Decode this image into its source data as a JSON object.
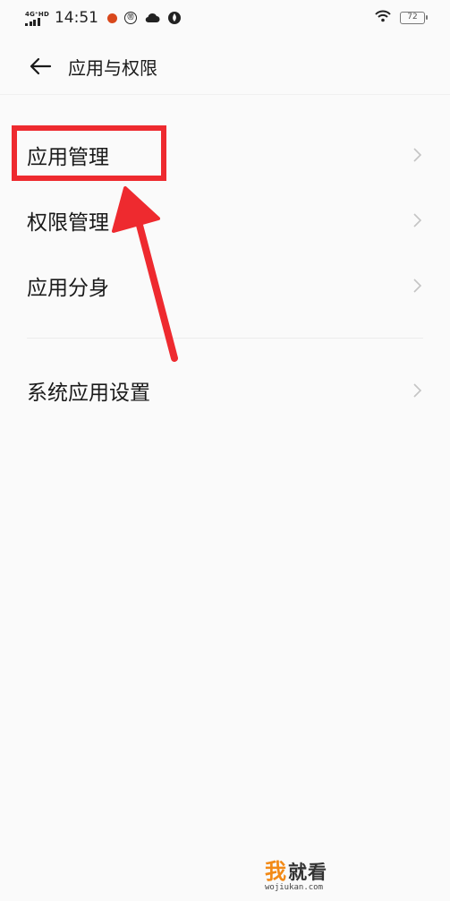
{
  "status_bar": {
    "network": "4G⁺HD",
    "time": "14:51",
    "circle_icon_text": "⑪",
    "battery": "72"
  },
  "header": {
    "title": "应用与权限"
  },
  "menu": {
    "items": [
      {
        "label": "应用管理"
      },
      {
        "label": "权限管理"
      },
      {
        "label": "应用分身"
      },
      {
        "label": "系统应用设置"
      }
    ]
  },
  "annotation": {
    "color": "#ee2a2f"
  },
  "watermark": {
    "brand_first": "我",
    "brand_rest": "就看",
    "url": "wojiukan.com",
    "accent_color": "#f28a17"
  }
}
